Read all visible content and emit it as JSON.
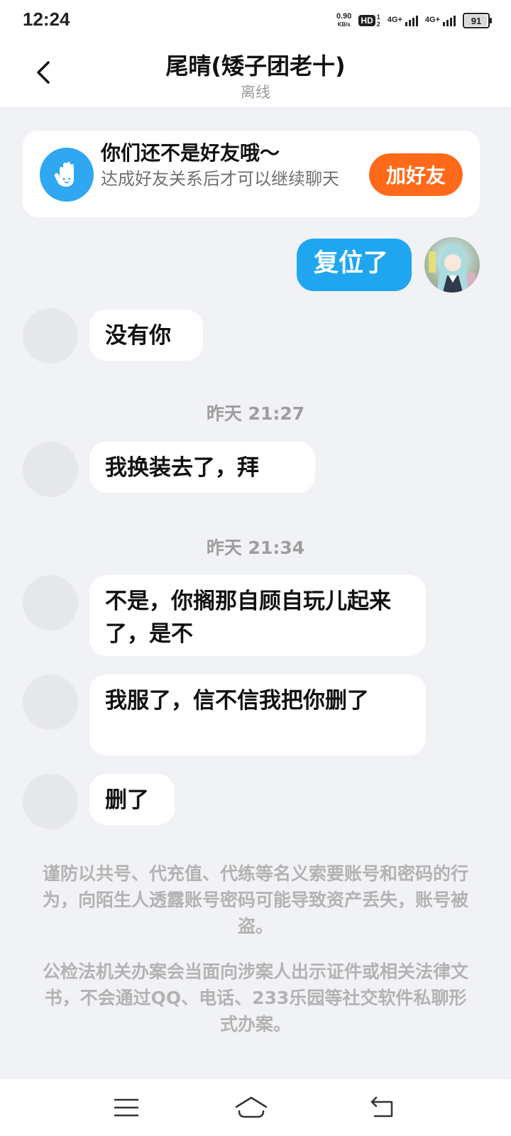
{
  "status_bar": {
    "time": "12:24",
    "net_speed_value": "0.90",
    "net_speed_unit": "KB/s",
    "hd_label": "HD",
    "hd_slot_1": "1",
    "hd_slot_2": "2",
    "signal_1_label": "4G+",
    "signal_2_label": "4G+",
    "battery_level": "91"
  },
  "header": {
    "title": "尾晴(矮子团老十)",
    "status": "离线",
    "back_icon": "chevron-left-icon"
  },
  "friend_card": {
    "title": "你们还不是好友哦～",
    "description": "达成好友关系后才可以继续聊天",
    "button_label": "加好友",
    "icon": "hand-icon",
    "accent_color": "#ff6a1a"
  },
  "messages": [
    {
      "sender": "me",
      "text": "复位了"
    },
    {
      "sender": "other",
      "text": "没有你"
    },
    {
      "type": "timestamp",
      "text": "昨天 21:27"
    },
    {
      "sender": "other",
      "text": "我换装去了，拜"
    },
    {
      "type": "timestamp",
      "text": "昨天 21:34"
    },
    {
      "sender": "other",
      "text": "不是，你搁那自顾自玩儿起来了，是不"
    },
    {
      "sender": "other",
      "text": "我服了，信不信我把你删了"
    },
    {
      "sender": "other",
      "text": "删了"
    }
  ],
  "notices": [
    "谨防以共号、代充值、代练等名义索要账号和密码的行为，向陌生人透露账号密码可能导致资产丢失，账号被盗。",
    "公检法机关办案会当面向涉案人出示证件或相关法律文书，不会通过QQ、电话、233乐园等社交软件私聊形式办案。"
  ],
  "nav_bar": {
    "menu_icon": "menu-icon",
    "home_icon": "home-icon",
    "back_icon": "back-arrow-icon"
  },
  "colors": {
    "my_bubble": "#20a6f0",
    "background": "#f1f2f5"
  }
}
